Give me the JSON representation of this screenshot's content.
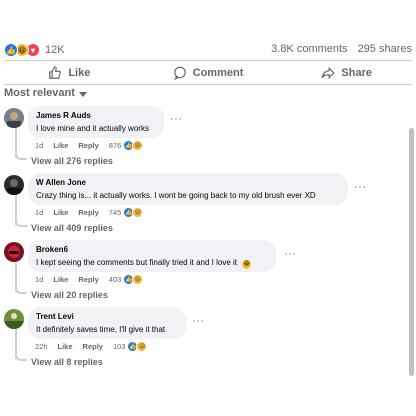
{
  "post_stats": {
    "reaction_icons": [
      "like-icon",
      "haha-icon",
      "love-icon"
    ],
    "reaction_count": "12K",
    "comments": "3.8K comments",
    "shares": "295 shares"
  },
  "actions": [
    {
      "label": "Like",
      "icon": "thumbs-up-icon"
    },
    {
      "label": "Comment",
      "icon": "comment-bubble-icon"
    },
    {
      "label": "Share",
      "icon": "share-arrow-icon"
    }
  ],
  "sort_label": "Most relevant",
  "comments": [
    {
      "author": "James R Auds",
      "text": "I love mine and it actually works",
      "time": "1d",
      "like": "Like",
      "reply": "Reply",
      "reactions": "876",
      "view_replies": "View all 276 replies"
    },
    {
      "author": "W Allen Jone",
      "text": "Crazy thing is... it actually works. I wont be going back to my old brush ever XD",
      "time": "1d",
      "like": "Like",
      "reply": "Reply",
      "reactions": "745",
      "view_replies": "View all 409 replies"
    },
    {
      "author": "Broken6",
      "text": "I kept seeing the comments but finally tried it and I love it",
      "time": "1d",
      "like": "Like",
      "reply": "Reply",
      "reactions": "403",
      "view_replies": "View all 20 replies"
    },
    {
      "author": "Trent Levi",
      "text": "It definitely saves time, I'll give it that",
      "time": "22h",
      "like": "Like",
      "reply": "Reply",
      "reactions": "103",
      "view_replies": "View all 8 replies"
    }
  ],
  "colors": {
    "accent": "#1877f2",
    "muted": "#65676b",
    "bubble": "#f0f2f5"
  }
}
